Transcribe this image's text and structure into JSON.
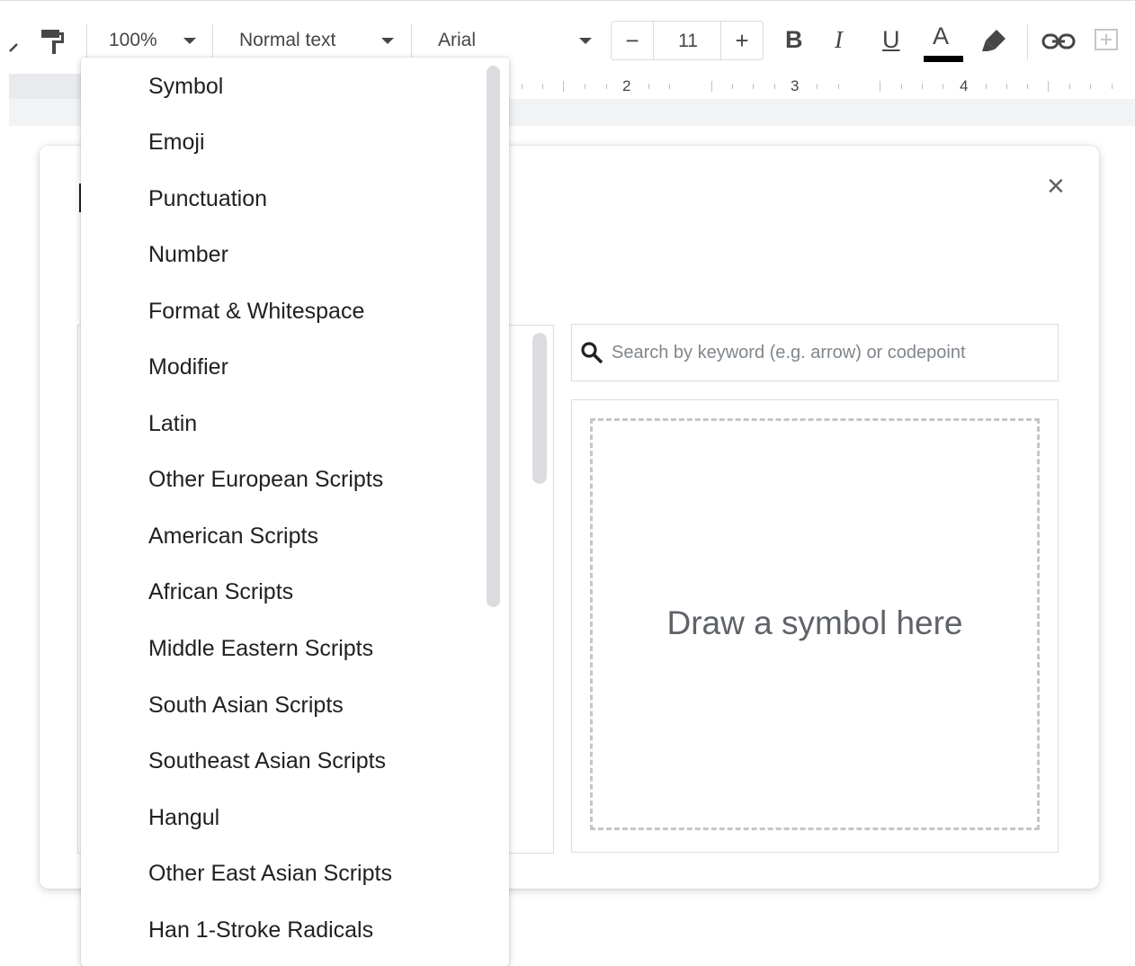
{
  "toolbar": {
    "zoom": "100%",
    "style": "Normal text",
    "font": "Arial",
    "font_size": "11",
    "minus": "−",
    "plus": "+",
    "bold": "B",
    "italic": "I",
    "underline": "U",
    "text_color": "A",
    "text_color_value": "#000000"
  },
  "ruler": {
    "labels": [
      "2",
      "3",
      "4"
    ]
  },
  "dialog": {
    "close": "×",
    "search_placeholder": "Search by keyword (e.g. arrow) or codepoint",
    "draw_label": "Draw a symbol here"
  },
  "dropdown": {
    "items": [
      "Symbol",
      "Emoji",
      "Punctuation",
      "Number",
      "Format & Whitespace",
      "Modifier",
      "Latin",
      "Other European Scripts",
      "American Scripts",
      "African Scripts",
      "Middle Eastern Scripts",
      "South Asian Scripts",
      "Southeast Asian Scripts",
      "Hangul",
      "Other East Asian Scripts",
      "Han 1-Stroke Radicals"
    ]
  }
}
